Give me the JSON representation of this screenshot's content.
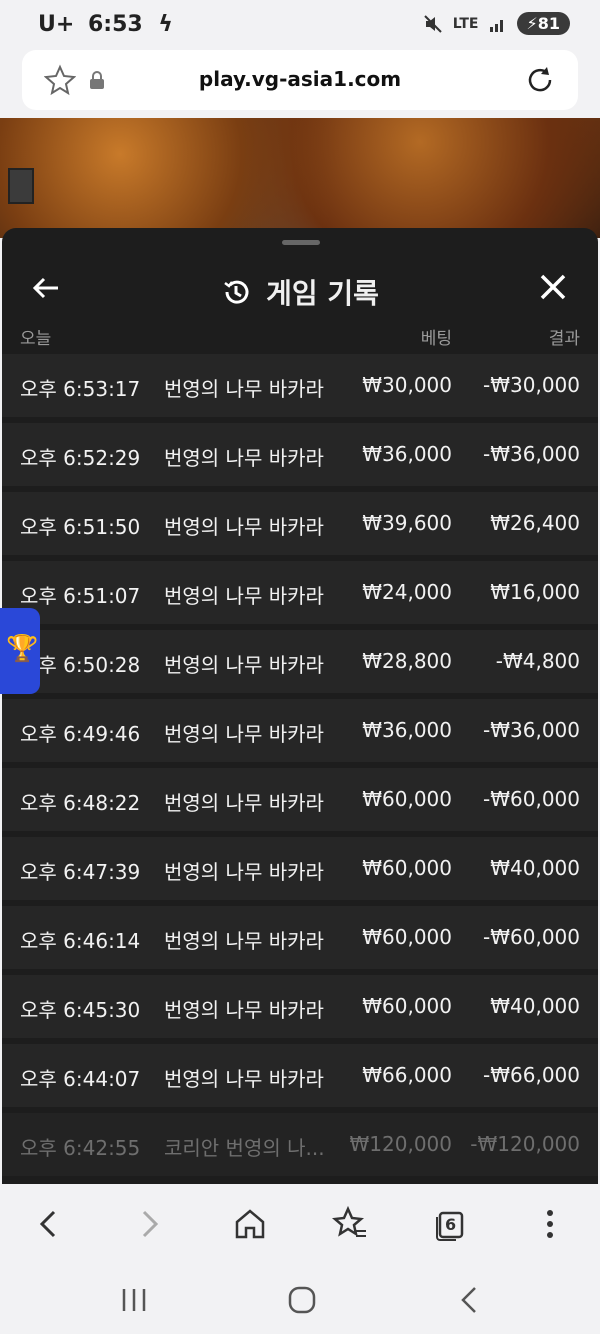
{
  "status_bar": {
    "carrier": "U+",
    "time": "6:53",
    "network": "LTE",
    "battery": "81"
  },
  "browser": {
    "url": "play.vg-asia1.com",
    "tabs_count": "6"
  },
  "panel": {
    "title": "게임 기록",
    "columns": {
      "date": "오늘",
      "bet": "베팅",
      "result": "결과"
    },
    "rows": [
      {
        "time": "오후 6:53:17",
        "game": "번영의 나무 바카라",
        "bet": "₩30,000",
        "result": "-₩30,000"
      },
      {
        "time": "오후 6:52:29",
        "game": "번영의 나무 바카라",
        "bet": "₩36,000",
        "result": "-₩36,000"
      },
      {
        "time": "오후 6:51:50",
        "game": "번영의 나무 바카라",
        "bet": "₩39,600",
        "result": "₩26,400"
      },
      {
        "time": "오후 6:51:07",
        "game": "번영의 나무 바카라",
        "bet": "₩24,000",
        "result": "₩16,000"
      },
      {
        "time": "오후 6:50:28",
        "game": "번영의 나무 바카라",
        "bet": "₩28,800",
        "result": "-₩4,800"
      },
      {
        "time": "오후 6:49:46",
        "game": "번영의 나무 바카라",
        "bet": "₩36,000",
        "result": "-₩36,000"
      },
      {
        "time": "오후 6:48:22",
        "game": "번영의 나무 바카라",
        "bet": "₩60,000",
        "result": "-₩60,000"
      },
      {
        "time": "오후 6:47:39",
        "game": "번영의 나무 바카라",
        "bet": "₩60,000",
        "result": "₩40,000"
      },
      {
        "time": "오후 6:46:14",
        "game": "번영의 나무 바카라",
        "bet": "₩60,000",
        "result": "-₩60,000"
      },
      {
        "time": "오후 6:45:30",
        "game": "번영의 나무 바카라",
        "bet": "₩60,000",
        "result": "₩40,000"
      },
      {
        "time": "오후 6:44:07",
        "game": "번영의 나무 바카라",
        "bet": "₩66,000",
        "result": "-₩66,000"
      },
      {
        "time": "오후 6:42:55",
        "game": "코리안 번영의 나...",
        "bet": "₩120,000",
        "result": "-₩120,000"
      }
    ]
  }
}
